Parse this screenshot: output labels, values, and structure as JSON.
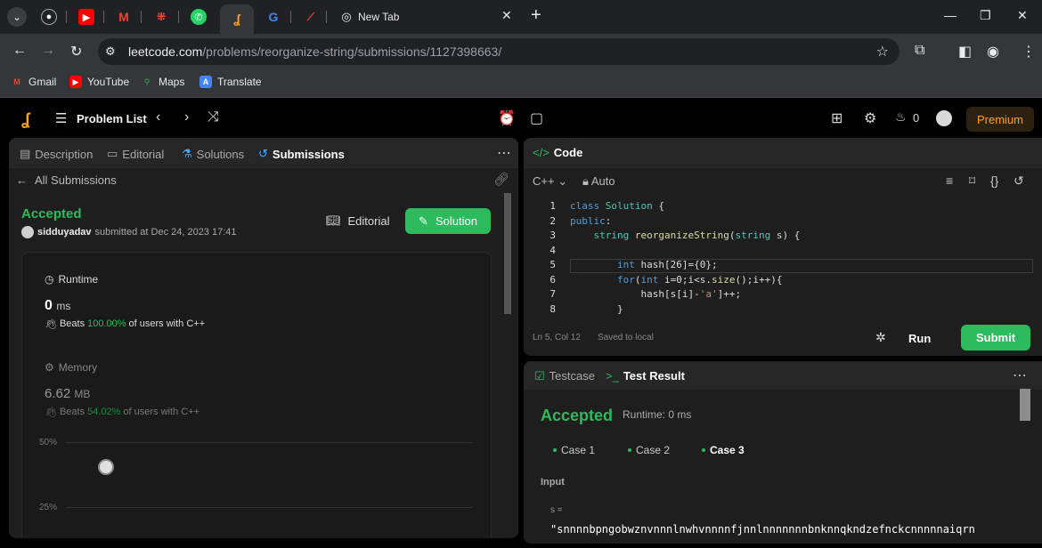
{
  "browser": {
    "tabs": {
      "active_favicon": "leetcode-icon",
      "new_tab_label": "New Tab"
    },
    "url": {
      "domain": "leetcode.com",
      "path": "/problems/reorganize-string/submissions/1127398663/"
    },
    "bookmarks": [
      {
        "label": "Gmail"
      },
      {
        "label": "YouTube"
      },
      {
        "label": "Maps"
      },
      {
        "label": "Translate"
      }
    ]
  },
  "header": {
    "problem_list": "Problem List",
    "streak_count": "0",
    "premium": "Premium"
  },
  "left": {
    "tabs": [
      "Description",
      "Editorial",
      "Solutions",
      "Submissions"
    ],
    "all_submissions": "All Submissions",
    "status": "Accepted",
    "user": "sidduyadav",
    "submitted_text": "submitted at Dec 24, 2023 17:41",
    "editorial_btn": "Editorial",
    "solution_btn": "Solution",
    "runtime": {
      "label": "Runtime",
      "value": "0",
      "unit": "ms",
      "beats_prefix": "Beats",
      "beats_pct": "100.00%",
      "beats_suffix": "of users with C++"
    },
    "memory": {
      "label": "Memory",
      "value": "6.62",
      "unit": "MB",
      "beats_prefix": "Beats",
      "beats_pct": "54.02%",
      "beats_suffix": "of users with C++"
    },
    "chart_ticks": [
      "50%",
      "25%"
    ]
  },
  "code": {
    "title": "Code",
    "language": "C++",
    "auto": "Auto",
    "lines": [
      {
        "n": "1"
      },
      {
        "n": "2"
      },
      {
        "n": "3"
      },
      {
        "n": "4"
      },
      {
        "n": "5"
      },
      {
        "n": "6"
      },
      {
        "n": "7"
      },
      {
        "n": "8"
      }
    ],
    "cursor": "Ln 5, Col 12",
    "saved": "Saved to local",
    "run": "Run",
    "submit": "Submit"
  },
  "test": {
    "tabs": [
      "Testcase",
      "Test Result"
    ],
    "status": "Accepted",
    "runtime": "Runtime: 0 ms",
    "cases": [
      "Case 1",
      "Case 2",
      "Case 3"
    ],
    "input_label": "Input",
    "var_label": "s =",
    "var_value": "\"snnnnbpngobwznvnnnlnwhvnnnnfjnnlnnnnnnnbnknnqkndzefnckcnnnnnaiqrn"
  },
  "colors": {
    "accent_green": "#2cbb5d",
    "brand_orange": "#ffa116"
  }
}
